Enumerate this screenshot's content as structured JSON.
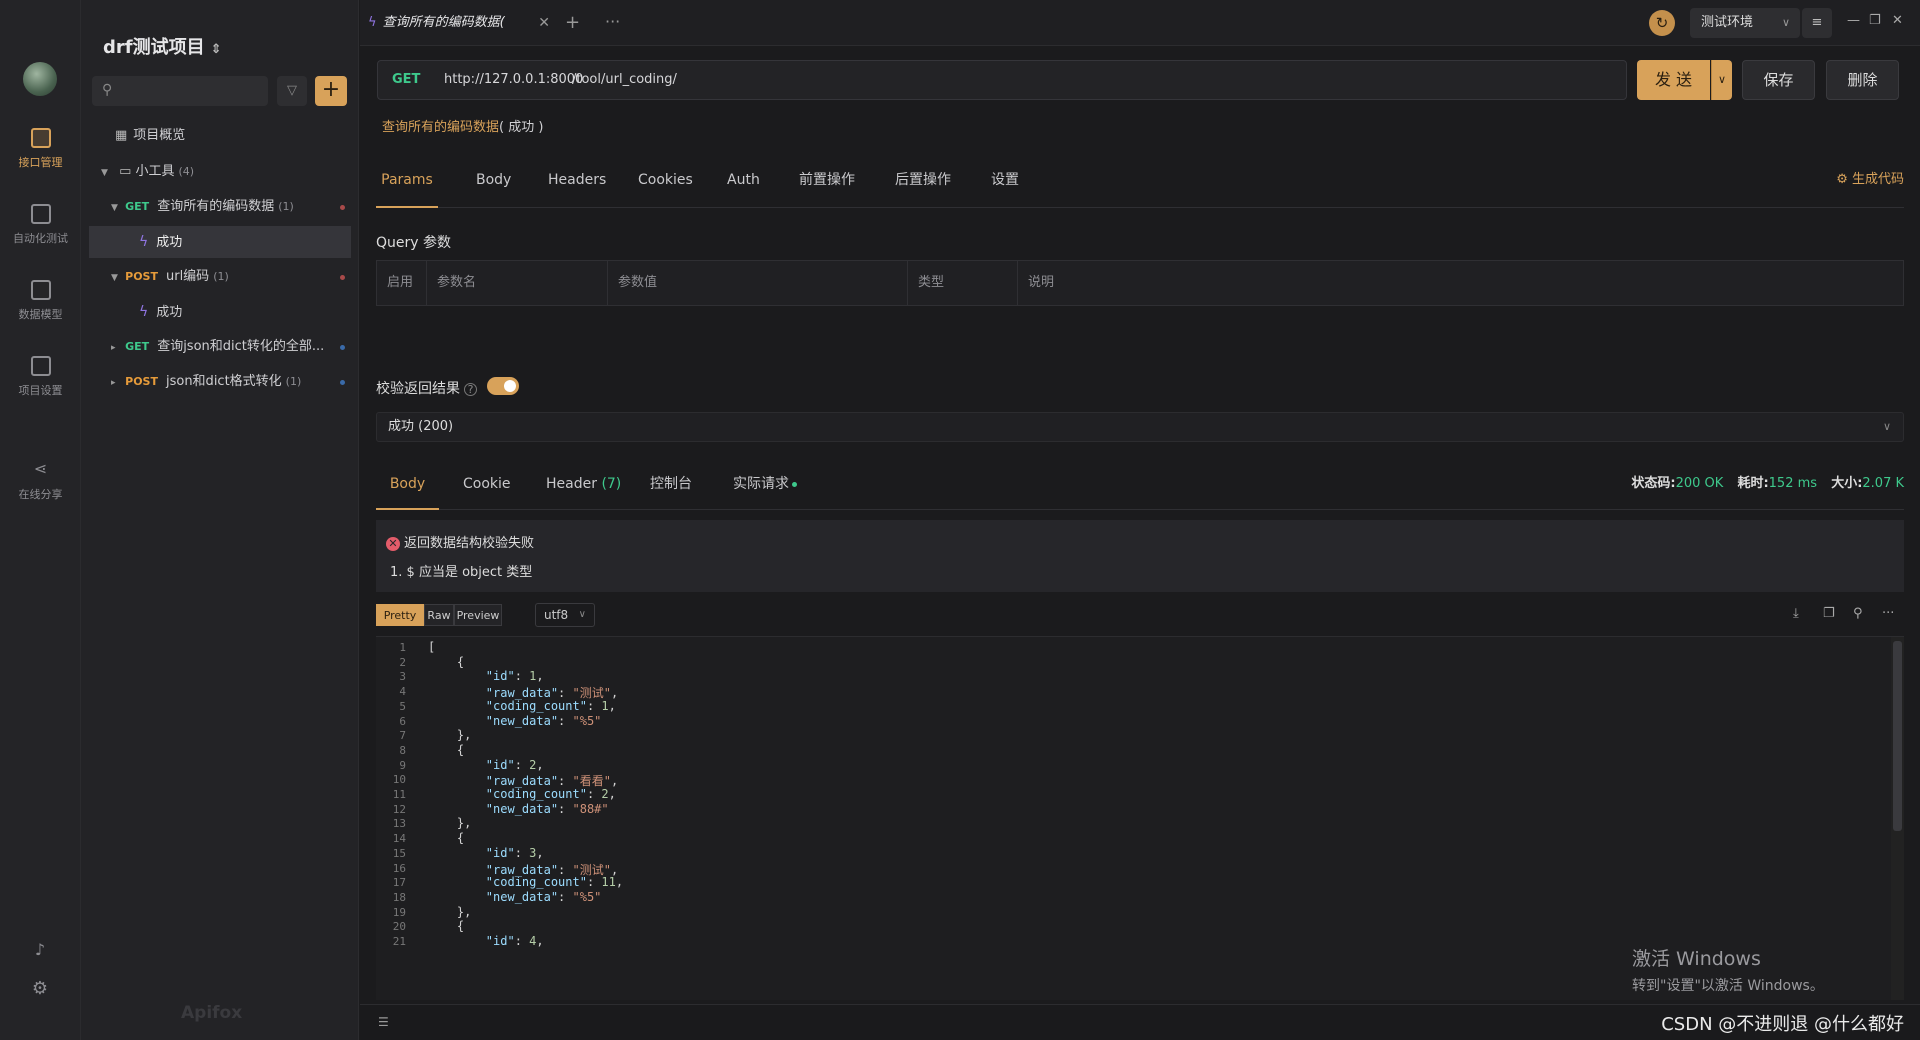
{
  "rail": {
    "items": [
      {
        "label": "接口管理",
        "icon": "api-management-icon"
      },
      {
        "label": "自动化测试",
        "icon": "automation-icon"
      },
      {
        "label": "数据模型",
        "icon": "data-model-icon"
      },
      {
        "label": "项目设置",
        "icon": "project-settings-icon"
      },
      {
        "label": "在线分享",
        "icon": "share-icon"
      }
    ]
  },
  "tree": {
    "project_title": "drf测试项目",
    "search_placeholder": "",
    "overview": "项目概览",
    "folder": {
      "name": "小工具",
      "count": "(4)"
    },
    "nodes": [
      {
        "method": "GET",
        "name": "查询所有的编码数据",
        "count": "(1)"
      },
      {
        "case": "成功"
      },
      {
        "method": "POST",
        "name": "url编码",
        "count": "(1)"
      },
      {
        "case": "成功"
      },
      {
        "method": "GET",
        "name": "查询json和dict转化的全部..."
      },
      {
        "method": "POST",
        "name": "json和dict格式转化",
        "count": "(1)"
      }
    ],
    "brand": "Apifox"
  },
  "tabbar": {
    "tab_title": "查询所有的编码数据(",
    "env": "测试环境"
  },
  "request": {
    "method": "GET",
    "base_url": "http://127.0.0.1:8000",
    "path": "/tool/url_coding/",
    "send": "发 送",
    "save": "保存",
    "delete": "删除",
    "name": "查询所有的编码数据",
    "case": "( 成功 )"
  },
  "req_tabs": [
    "Params",
    "Body",
    "Headers",
    "Cookies",
    "Auth",
    "前置操作",
    "后置操作",
    "设置"
  ],
  "gen_code": "生成代码",
  "query": {
    "label": "Query 参数",
    "columns": [
      "启用",
      "参数名",
      "参数值",
      "类型",
      "说明"
    ]
  },
  "validate": {
    "label": "校验返回结果",
    "enabled": true,
    "response": "成功 (200)"
  },
  "resp_tabs": {
    "body": "Body",
    "cookie": "Cookie",
    "header": "Header",
    "header_count": "(7)",
    "console": "控制台",
    "actual": "实际请求"
  },
  "stats": {
    "status_label": "状态码:",
    "status": "200 OK",
    "time_label": "耗时:",
    "time": "152 ms",
    "size_label": "大小:",
    "size": "2.07 K"
  },
  "error": {
    "title": "返回数据结构校验失败",
    "detail": "1. $ 应当是 object 类型"
  },
  "format": {
    "pretty": "Pretty",
    "raw": "Raw",
    "preview": "Preview",
    "encoding": "utf8"
  },
  "code_lines": [
    "[",
    "    {",
    "        \"id\": 1,",
    "        \"raw_data\": \"测试\",",
    "        \"coding_count\": 1,",
    "        \"new_data\": \"%5\"",
    "    },",
    "    {",
    "        \"id\": 2,",
    "        \"raw_data\": \"看看\",",
    "        \"coding_count\": 2,",
    "        \"new_data\": \"88#\"",
    "    },",
    "    {",
    "        \"id\": 3,",
    "        \"raw_data\": \"测试\",",
    "        \"coding_count\": 11,",
    "        \"new_data\": \"%5\"",
    "    },",
    "    {",
    "        \"id\": 4,"
  ],
  "overlay": {
    "activate_title": "激活 Windows",
    "activate_sub": "转到\"设置\"以激活 Windows。",
    "watermark": "CSDN @不进则退 @什么都好"
  }
}
